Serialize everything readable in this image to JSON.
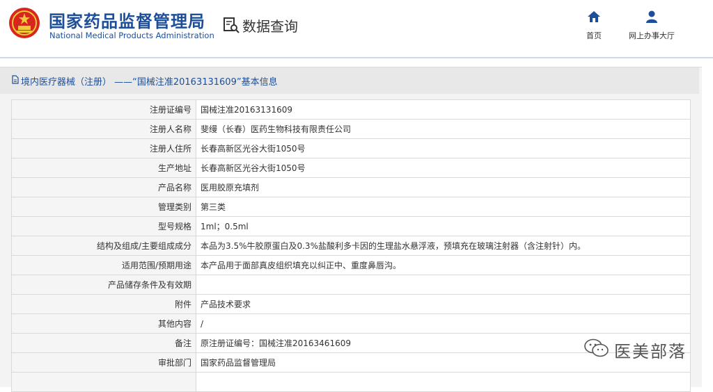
{
  "header": {
    "agency_cn": "国家药品监督管理局",
    "agency_en": "National Medical Products Administration",
    "query_title": "数据查询",
    "nav": {
      "home": "首页",
      "online_hall": "网上办事大厅"
    }
  },
  "panel": {
    "title": "境内医疗器械（注册） ——“国械注准20163131609”基本信息",
    "rows": [
      {
        "label": "注册证编号",
        "value": "国械注准20163131609"
      },
      {
        "label": "注册人名称",
        "value": "斐缦（长春）医药生物科技有限责任公司"
      },
      {
        "label": "注册人住所",
        "value": "长春高新区光谷大街1050号"
      },
      {
        "label": "生产地址",
        "value": "长春高新区光谷大街1050号"
      },
      {
        "label": "产品名称",
        "value": "医用胶原充填剂"
      },
      {
        "label": "管理类别",
        "value": "第三类"
      },
      {
        "label": "型号规格",
        "value": "1ml；0.5ml"
      },
      {
        "label": "结构及组成/主要组成成分",
        "value": "本品为3.5%牛胶原蛋白及0.3%盐酸利多卡因的生理盐水悬浮液，预填充在玻璃注射器（含注射针）内。"
      },
      {
        "label": "适用范围/预期用途",
        "value": "本产品用于面部真皮组织填充以纠正中、重度鼻唇沟。"
      },
      {
        "label": "产品储存条件及有效期",
        "value": ""
      },
      {
        "label": "附件",
        "value": "产品技术要求"
      },
      {
        "label": "其他内容",
        "value": "/"
      },
      {
        "label": "备注",
        "value": "原注册证编号：国械注准20163461609"
      },
      {
        "label": "审批部门",
        "value": "国家药品监督管理局"
      },
      {
        "label": "",
        "value": ""
      }
    ]
  },
  "watermark": {
    "text": "医美部落"
  },
  "colors": {
    "brand": "#1c4e9a",
    "panel_bg": "#f3f3f3",
    "title_bar": "#e8e8e8",
    "border": "#d9d9d9"
  }
}
